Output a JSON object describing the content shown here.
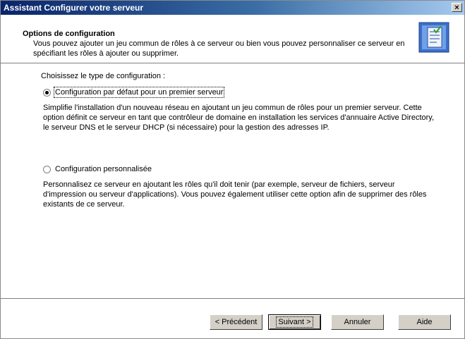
{
  "window": {
    "title": "Assistant Configurer votre serveur",
    "close_glyph": "×"
  },
  "header": {
    "title": "Options de configuration",
    "description": "Vous pouvez ajouter un jeu commun de rôles à ce serveur ou bien vous pouvez personnaliser ce serveur en spécifiant les rôles à ajouter ou supprimer.",
    "icon": "wizard-checklist-icon"
  },
  "content": {
    "prompt": "Choisissez le type de configuration :",
    "options": [
      {
        "label": "Configuration par défaut pour un premier serveur",
        "checked": true,
        "description": "Simplifie l'installation d'un nouveau réseau en ajoutant un jeu commun de rôles pour un premier serveur. Cette option définit ce serveur en tant que contrôleur de domaine en installation les services d'annuaire Active Directory, le serveur DNS et le serveur DHCP (si nécessaire) pour la gestion des adresses IP."
      },
      {
        "label": "Configuration personnalisée",
        "checked": false,
        "description": "Personnalisez ce serveur en ajoutant les rôles qu'il doit tenir (par exemple, serveur de fichiers, serveur d'impression ou serveur d'applications). Vous pouvez également utiliser cette option afin de supprimer des rôles existants de ce serveur."
      }
    ]
  },
  "footer": {
    "back_label": "< Précédent",
    "next_label": "Suivant >",
    "cancel_label": "Annuler",
    "help_label": "Aide"
  },
  "colors": {
    "titlebar_start": "#0a246a",
    "titlebar_end": "#a6caf0",
    "button_face": "#d4d0c8"
  }
}
